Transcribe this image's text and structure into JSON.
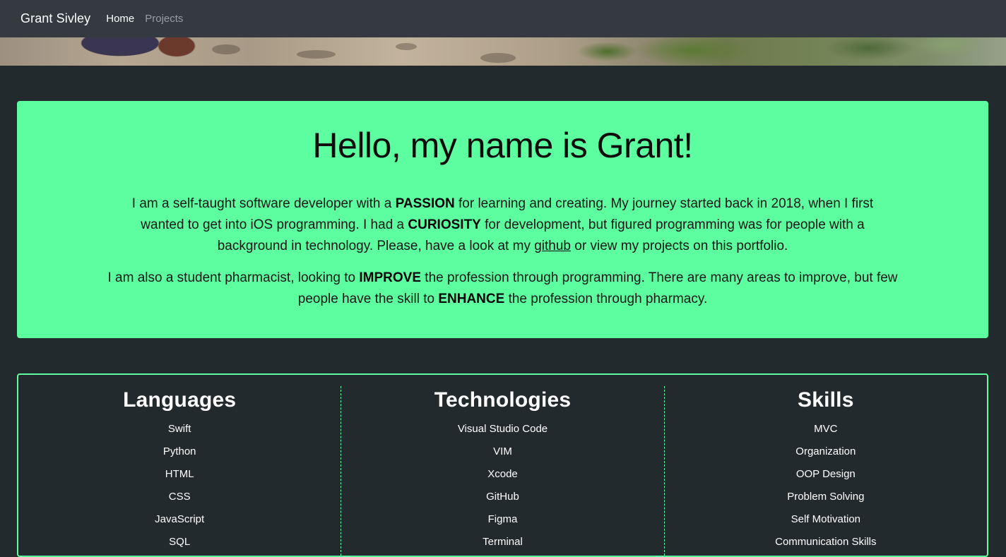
{
  "nav": {
    "brand": "Grant Sivley",
    "links": [
      {
        "label": "Home",
        "active": true
      },
      {
        "label": "Projects",
        "active": false
      }
    ]
  },
  "intro": {
    "heading_prefix": "Hello, my name is ",
    "heading_name": "Grant!",
    "p1": {
      "t1": "I am a self-taught software developer with a ",
      "b1": "PASSION",
      "t2": " for learning and creating. My journey started back in 2018, when I first wanted to get into iOS programming. I had a ",
      "b2": "CURIOSITY",
      "t3": " for development, but figured programming was for people with a background in technology. Please, have a look at my ",
      "link": "github",
      "t4": " or view my projects on this portfolio."
    },
    "p2": {
      "t1": "I am also a student pharmacist, looking to ",
      "b1": "IMPROVE",
      "t2": " the profession through programming. There are many areas to improve, but few people have the skill to ",
      "b2": "ENHANCE",
      "t3": " the profession through pharmacy."
    }
  },
  "columns": [
    {
      "title": "Languages",
      "items": [
        "Swift",
        "Python",
        "HTML",
        "CSS",
        "JavaScript",
        "SQL"
      ]
    },
    {
      "title": "Technologies",
      "items": [
        "Visual Studio Code",
        "VIM",
        "Xcode",
        "GitHub",
        "Figma",
        "Terminal"
      ]
    },
    {
      "title": "Skills",
      "items": [
        "MVC",
        "Organization",
        "OOP Design",
        "Problem Solving",
        "Self Motivation",
        "Communication Skills"
      ]
    }
  ],
  "colors": {
    "accent": "#5cfe9f",
    "background": "#232a2d",
    "navbar": "#343a40"
  }
}
